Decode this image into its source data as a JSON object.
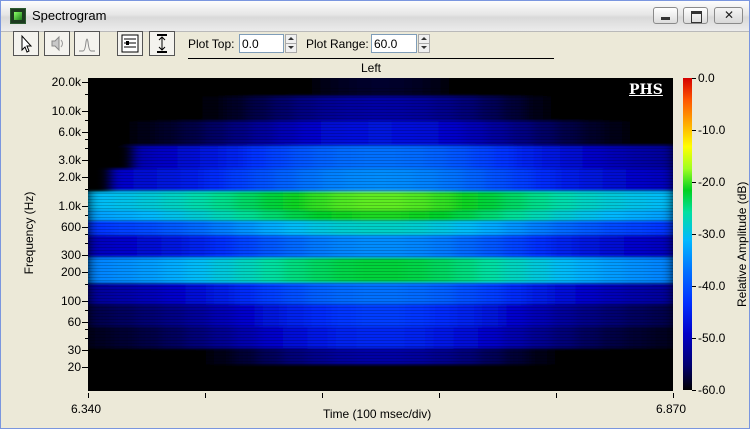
{
  "window": {
    "title": "Spectrogram"
  },
  "toolbar": {
    "plot_top_label": "Plot Top:",
    "plot_top_value": "0.0",
    "plot_range_label": "Plot Range:",
    "plot_range_value": "60.0"
  },
  "icons": [
    "pointer-icon",
    "speaker-icon",
    "spectrum-icon",
    "settings-icon",
    "vertical-range-icon"
  ],
  "channel_label": "Left",
  "watermark": "PHS",
  "chart_data": {
    "type": "heatmap",
    "xlabel": "Time (100 msec/div)",
    "ylabel": "Frequency (Hz)",
    "x_tick_labels": [
      "6.340",
      "6.870"
    ],
    "x_range": [
      6.34,
      6.87
    ],
    "y_tick_labels": [
      "20.0k",
      "10.0k",
      "6.0k",
      "3.0k",
      "2.0k",
      "1.0k",
      "600",
      "300",
      "200",
      "100",
      "60",
      "30",
      "20"
    ],
    "y_scale": "log",
    "colorbar": {
      "label": "Relative Amplitude (dB)",
      "tick_labels": [
        "0.0",
        "-10.0",
        "-20.0",
        "-30.0",
        "-40.0",
        "-50.0",
        "-60.0"
      ],
      "range": [
        -60,
        0
      ]
    },
    "bands": [
      {
        "freq_hz": 20000,
        "db": -58,
        "t_start": 6.38,
        "t_end": 6.78
      },
      {
        "freq_hz": 10000,
        "db": -52,
        "t_start": 6.36,
        "t_end": 6.86
      },
      {
        "freq_hz": 6000,
        "db": -48,
        "t_start": 6.36,
        "t_end": 6.87
      },
      {
        "freq_hz": 3000,
        "db": -40,
        "t_start": 6.38,
        "t_end": 6.87
      },
      {
        "freq_hz": 2000,
        "db": -38,
        "t_start": 6.36,
        "t_end": 6.87
      },
      {
        "freq_hz": 1000,
        "db": -22,
        "t_start": 6.34,
        "t_end": 6.87
      },
      {
        "freq_hz": 800,
        "db": -24,
        "t_start": 6.34,
        "t_end": 6.87
      },
      {
        "freq_hz": 600,
        "db": -32,
        "t_start": 6.34,
        "t_end": 6.87
      },
      {
        "freq_hz": 400,
        "db": -38,
        "t_start": 6.34,
        "t_end": 6.87
      },
      {
        "freq_hz": 200,
        "db": -26,
        "t_start": 6.34,
        "t_end": 6.87
      },
      {
        "freq_hz": 120,
        "db": -40,
        "t_start": 6.34,
        "t_end": 6.87
      },
      {
        "freq_hz": 70,
        "db": -44,
        "t_start": 6.34,
        "t_end": 6.87
      },
      {
        "freq_hz": 40,
        "db": -46,
        "t_start": 6.34,
        "t_end": 6.87
      },
      {
        "freq_hz": 25,
        "db": -52,
        "t_start": 6.34,
        "t_end": 6.87
      }
    ]
  }
}
